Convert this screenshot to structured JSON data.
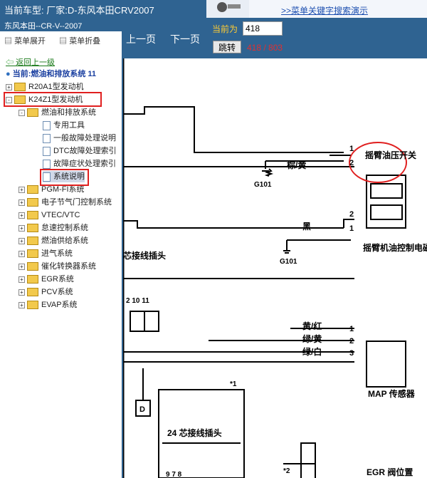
{
  "topbar": {
    "car_label": "当前车型:  厂家:D-东风本田CRV2007",
    "demo_link": ">>菜单关键字搜索演示"
  },
  "sidebar": {
    "header": "东风本田--CR-V--2007",
    "expand_label": "菜单展开",
    "collapse_label": "菜单折叠",
    "back_label": "返回上一级",
    "current_label": "当前:燃油和排放系统 11",
    "items": [
      {
        "label": "R20A1型发动机"
      },
      {
        "label": "K24Z1型发动机"
      },
      {
        "label": "燃油和排放系统"
      },
      {
        "label": "专用工具"
      },
      {
        "label": "一般故障处理说明"
      },
      {
        "label": "DTC故障处理索引"
      },
      {
        "label": "故障症状处理索引"
      },
      {
        "label": "系统说明"
      },
      {
        "label": "PGM-FI系统"
      },
      {
        "label": "电子节气门控制系统"
      },
      {
        "label": "VTEC/VTC"
      },
      {
        "label": "怠速控制系统"
      },
      {
        "label": "燃油供给系统"
      },
      {
        "label": "进气系统"
      },
      {
        "label": "催化转换器系统"
      },
      {
        "label": "EGR系统"
      },
      {
        "label": "PCV系统"
      },
      {
        "label": "EVAP系统"
      }
    ]
  },
  "nav": {
    "prev": "上一页",
    "next": "下一页",
    "current_label": "当前为",
    "page_value": "418",
    "jump": "跳转",
    "count": "418 / 803"
  },
  "diagram": {
    "wire_brown_yellow": "棕/黄",
    "wire_black": "黑",
    "g101_a": "G101",
    "g101_b": "G101",
    "oil_switch": "摇臂油压开关",
    "solenoid": "摇臂机油控制电磁阀",
    "conn_title": "芯接线插头",
    "pins": "2  10  11",
    "wire_yel_red": "黄/红",
    "wire_grn_yel": "绿/黄",
    "wire_grn_wht": "绿/白",
    "map_sensor": "MAP 传感器",
    "label_d": "D",
    "star1": "*1",
    "conn24": "24 芯接线插头",
    "pins24": "9   7   8",
    "star2": "*2",
    "egr_pos": "EGR 阀位置",
    "n1": "1",
    "n2": "2",
    "n3": "2",
    "n4": "1",
    "n5": "1",
    "n6": "2",
    "n7": "3"
  }
}
